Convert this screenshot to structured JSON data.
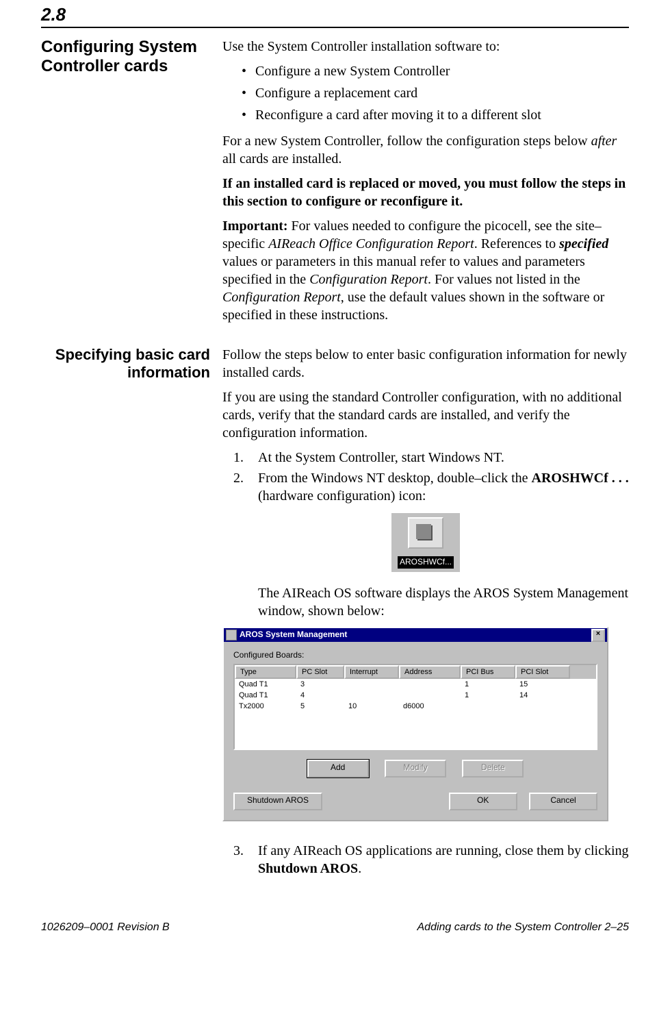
{
  "section_number": "2.8",
  "block1": {
    "heading": "Configuring System Controller cards",
    "intro": "Use the System Controller installation software to:",
    "bullets": [
      "Configure a new System Controller",
      "Configure a replacement card",
      "Reconfigure a card after moving it to a different slot"
    ],
    "para_new_a": "For a new System Controller, follow the configuration steps below ",
    "para_new_after_word": "after",
    "para_new_b": " all cards are installed.",
    "bold_para": "If an installed card is replaced or moved, you must follow the steps in this section to configure or reconfigure it.",
    "important_label": "Important:",
    "important_a": " For values needed to configure the picocell, see the site–specific ",
    "important_em1": "AIReach Office Configuration Report",
    "important_b": ". References to ",
    "important_em2": "specified",
    "important_c": " values or parameters in this manual refer to values and parameters specified in the ",
    "important_em3": "Configuration Report",
    "important_d": ". For values not listed in the ",
    "important_em4": "Configuration Report",
    "important_e": ", use the default values shown in the software or specified in these instructions."
  },
  "block2": {
    "heading": "Specifying basic card information",
    "para1": "Follow the steps below to enter basic configuration information for newly installed cards.",
    "para2": "If you are using the standard Controller configuration, with no additional cards, verify that the standard cards are installed, and verify the configuration information.",
    "step1": "At the System Controller, start Windows NT.",
    "step2_a": "From the Windows NT desktop, double–click the ",
    "step2_bold": "AROSHWCf . . .",
    "step2_b": " (hardware configuration) icon:",
    "icon_label": "AROSHWCf...",
    "after_icon": "The AIReach OS software displays the AROS System Management window, shown below:",
    "step3_a": "If any AIReach OS applications are running, close them by clicking ",
    "step3_bold": "Shutdown AROS",
    "step3_b": "."
  },
  "dialog": {
    "title": "AROS System Management",
    "close_glyph": "×",
    "configured_label": "Configured Boards:",
    "headers": [
      "Type",
      "PC Slot",
      "Interrupt",
      "Address",
      "PCI Bus",
      "PCI Slot"
    ],
    "rows": [
      {
        "type": "Quad T1",
        "pcslot": "3",
        "interrupt": "",
        "address": "",
        "pcibus": "1",
        "pcislot": "15"
      },
      {
        "type": "Quad T1",
        "pcslot": "4",
        "interrupt": "",
        "address": "",
        "pcibus": "1",
        "pcislot": "14"
      },
      {
        "type": "Tx2000",
        "pcslot": "5",
        "interrupt": "10",
        "address": "d6000",
        "pcibus": "",
        "pcislot": ""
      }
    ],
    "buttons": {
      "add": "Add",
      "modify": "Modify",
      "delete": "Delete",
      "shutdown": "Shutdown AROS",
      "ok": "OK",
      "cancel": "Cancel"
    }
  },
  "footer": {
    "left": "1026209–0001  Revision B",
    "right": "Adding cards to the System Controller   2–25"
  }
}
